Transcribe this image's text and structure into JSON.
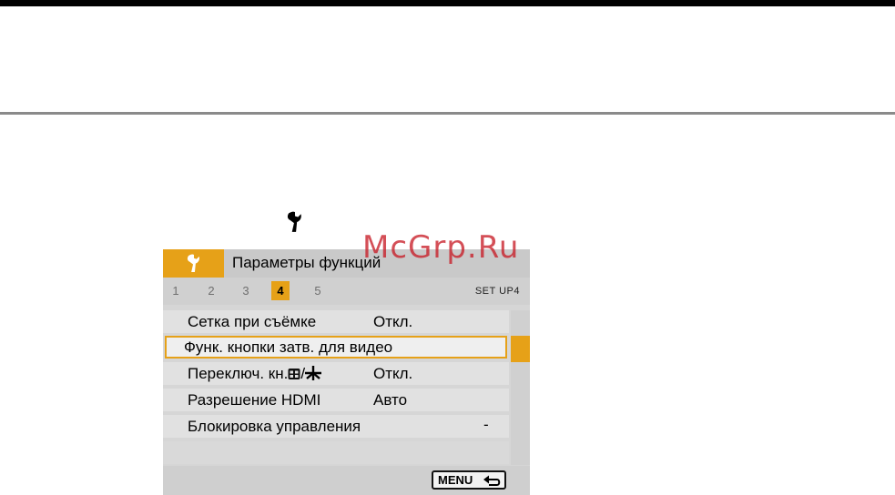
{
  "watermark": "McGrp.Ru",
  "icons": {
    "wrench": "wrench-icon",
    "menu_return": "return-arrow-icon",
    "info_display": "info-display-icon",
    "ae_lock": "ae-lock-asterisk-icon"
  },
  "colors": {
    "accent": "#e6a118",
    "watermark": "#c81e28"
  },
  "header": {
    "title": "Параметры функций"
  },
  "tabs": {
    "items": [
      "1",
      "2",
      "3",
      "4",
      "5"
    ],
    "active_index": 3,
    "section_label": "SET UP4"
  },
  "menu": {
    "items": [
      {
        "label": "Сетка при съёмке",
        "value": "Откл."
      },
      {
        "label": "Функ. кнопки затв. для видео",
        "value": ""
      },
      {
        "label_prefix": "Переключ. кн.",
        "label_suffix": "/",
        "value": "Откл."
      },
      {
        "label": "Разрешение HDMI",
        "value": "Авто"
      },
      {
        "label": "Блокировка управления",
        "value": "-"
      }
    ],
    "selected_index": 1
  },
  "footer": {
    "menu_label": "MENU"
  }
}
